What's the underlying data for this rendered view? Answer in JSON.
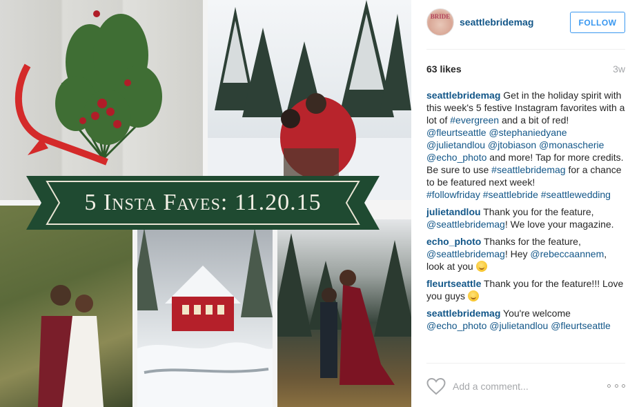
{
  "post": {
    "banner_text": "5 Insta Faves: 11.20.15",
    "avatar_text": "BRIDE"
  },
  "header": {
    "username": "seattlebridemag",
    "follow_label": "FOLLOW"
  },
  "stats": {
    "likes": "63 likes",
    "age": "3w"
  },
  "caption": {
    "user": "seattlebridemag",
    "text1": " Get in the holiday spirit with this week's 5 festive Instagram favorites with a lot of ",
    "tag_evergreen": "#evergreen",
    "text2": " and a bit of red!",
    "mentions1": "@fleurtseattle @stephaniedyane @julietandlou @jtobiason @monascherie @echo_photo",
    "text3": " and more! Tap for more credits.",
    "text4": "Be sure to use ",
    "tag_seattlebridemag": "#seattlebridemag",
    "text5": " for a chance to be featured next week!",
    "tags_end": "#followfriday #seattlebride #seattlewedding"
  },
  "comments": [
    {
      "user": "julietandlou",
      "text1": " Thank you for the feature, ",
      "mention": "@seattlebridemag",
      "text2": "! We love your magazine."
    },
    {
      "user": "echo_photo",
      "text1": " Thanks for the feature, ",
      "mention": "@seattlebridemag",
      "text2": "! Hey ",
      "mention2": "@rebeccaannem",
      "text3": ", look at you"
    },
    {
      "user": "fleurtseattle",
      "text1": " Thank you for the feature!!! Love you guys"
    },
    {
      "user": "seattlebridemag",
      "text1": " You're welcome",
      "mentions": "@echo_photo @julietandlou @fleurtseattle"
    }
  ],
  "footer": {
    "comment_placeholder": "Add a comment..."
  },
  "icons": {
    "heart": "heart-icon",
    "more": "more-options-icon",
    "emoji": "smiley-emoji"
  },
  "colors": {
    "link": "#125688",
    "follow": "#3897f0",
    "banner": "#1f4a31"
  }
}
